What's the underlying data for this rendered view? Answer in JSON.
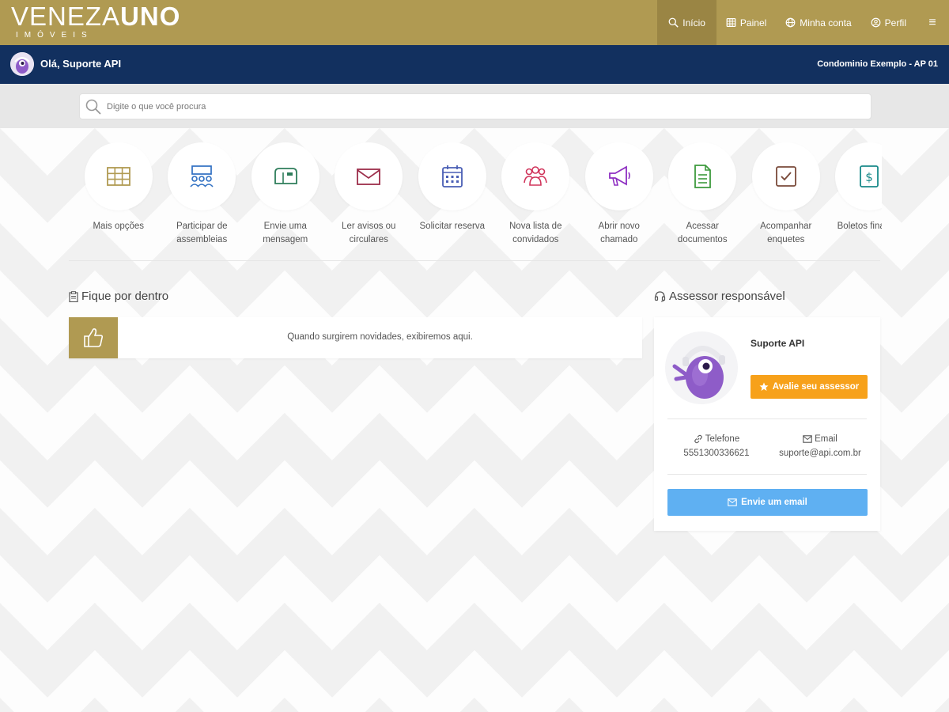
{
  "brand": {
    "name_thin": "VENEZA",
    "name_bold": "UNO",
    "tagline": "IMÓVEIS",
    "color": "#b09a52"
  },
  "nav": {
    "items": [
      {
        "label": "Início",
        "icon": "search-icon"
      },
      {
        "label": "Painel",
        "icon": "grid-icon"
      },
      {
        "label": "Minha conta",
        "icon": "globe-icon"
      },
      {
        "label": "Perfil",
        "icon": "user-circle-icon"
      }
    ],
    "menu_glyph": "≡"
  },
  "userbar": {
    "greeting": "Olá, Suporte API",
    "unit": "Condominio Exemplo - AP 01",
    "color": "#12305f"
  },
  "search": {
    "placeholder": "Digite o que você procura"
  },
  "shortcuts": [
    {
      "label": "Mais opções",
      "icon": "grid-table-icon",
      "color": "#b09a52"
    },
    {
      "label": "Participar de assembleias",
      "icon": "assembly-icon",
      "color": "#2f6fc2"
    },
    {
      "label": "Envie uma mensagem",
      "icon": "mailbox-icon",
      "color": "#2e7d5b"
    },
    {
      "label": "Ler avisos ou circulares",
      "icon": "envelope-icon",
      "color": "#9c2d4a"
    },
    {
      "label": "Solicitar reserva",
      "icon": "calendar-icon",
      "color": "#4a5fb5"
    },
    {
      "label": "Nova lista de convidados",
      "icon": "group-icon",
      "color": "#d0335a"
    },
    {
      "label": "Abrir novo chamado",
      "icon": "megaphone-icon",
      "color": "#8e2fc2"
    },
    {
      "label": "Acessar documentos",
      "icon": "document-icon",
      "color": "#3d9a3d"
    },
    {
      "label": "Acompanhar enquetes",
      "icon": "checkbox-icon",
      "color": "#7a4a3a"
    },
    {
      "label": "Boletos financei",
      "icon": "dollar-icon",
      "color": "#1a8a8a"
    }
  ],
  "news": {
    "title": "Fique por dentro",
    "empty_message": "Quando surgirem novidades, exibiremos aqui."
  },
  "advisor": {
    "title": "Assessor responsável",
    "name": "Suporte API",
    "rate_button": "Avalie seu assessor",
    "phone_label": "Telefone",
    "phone": "5551300336621",
    "email_label": "Email",
    "email": "suporte@api.com.br",
    "email_button": "Envie um email",
    "rate_color": "#f7a11a",
    "email_button_color": "#5fb0f2"
  }
}
